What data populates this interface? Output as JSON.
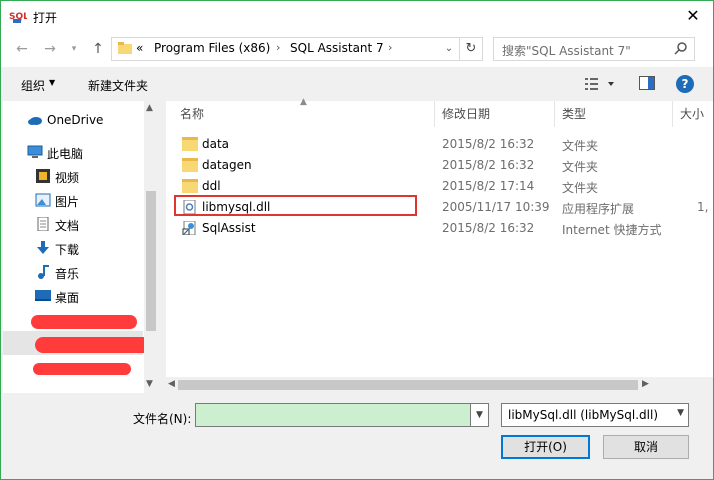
{
  "window": {
    "title": "打开",
    "app_icon_text": "SQL"
  },
  "nav": {
    "breadcrumb": [
      {
        "label": "«"
      },
      {
        "label": "Program Files (x86)"
      },
      {
        "label": "SQL Assistant 7"
      }
    ],
    "search_placeholder": "搜索\"SQL Assistant 7\""
  },
  "toolbar": {
    "organize_label": "组织",
    "new_folder_label": "新建文件夹"
  },
  "sidebar": {
    "items": [
      {
        "label": "OneDrive",
        "icon": "cloud-icon"
      },
      {
        "label": "此电脑",
        "icon": "computer-icon"
      },
      {
        "label": "视频",
        "icon": "video-icon"
      },
      {
        "label": "图片",
        "icon": "picture-icon"
      },
      {
        "label": "文档",
        "icon": "document-icon"
      },
      {
        "label": "下载",
        "icon": "download-icon"
      },
      {
        "label": "音乐",
        "icon": "music-icon"
      },
      {
        "label": "桌面",
        "icon": "desktop-icon"
      }
    ]
  },
  "filelist": {
    "columns": [
      "名称",
      "修改日期",
      "类型",
      "大小"
    ],
    "rows": [
      {
        "name": "data",
        "date": "2015/8/2 16:32",
        "type": "文件夹",
        "size": "",
        "icon": "folder-icon"
      },
      {
        "name": "datagen",
        "date": "2015/8/2 16:32",
        "type": "文件夹",
        "size": "",
        "icon": "folder-icon"
      },
      {
        "name": "ddl",
        "date": "2015/8/2 17:14",
        "type": "文件夹",
        "size": "",
        "icon": "folder-icon"
      },
      {
        "name": "libmysql.dll",
        "date": "2005/11/17 10:39",
        "type": "应用程序扩展",
        "size": "1,",
        "icon": "dll-file-icon"
      },
      {
        "name": "SqlAssist",
        "date": "2015/8/2 16:32",
        "type": "Internet 快捷方式",
        "size": "",
        "icon": "shortcut-icon"
      }
    ]
  },
  "footer": {
    "filename_label": "文件名(N):",
    "filename_value": "",
    "filetype_value": "libMySql.dll (libMySql.dll)",
    "open_label": "打开(O)",
    "cancel_label": "取消"
  },
  "colors": {
    "highlight": "#e0342e",
    "filename_bg": "#ccefd0",
    "redaction": "#ff3b3b"
  }
}
